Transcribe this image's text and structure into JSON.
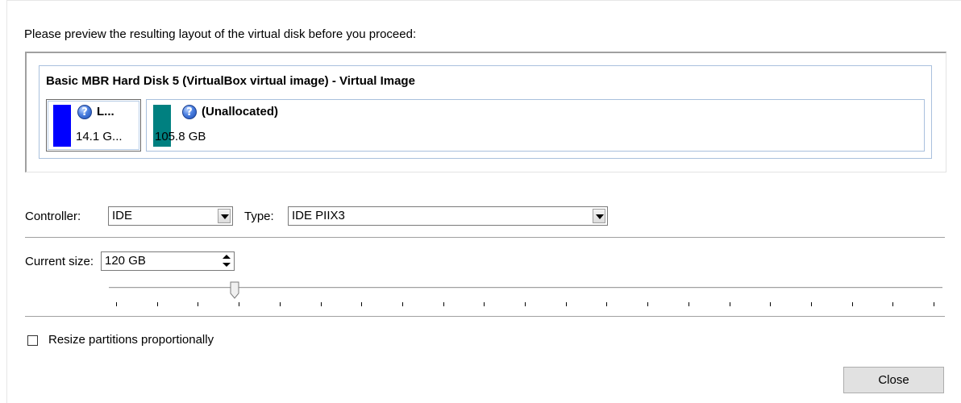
{
  "intro_text": "Please preview the resulting layout of the virtual disk before you proceed:",
  "disk": {
    "title": "Basic MBR Hard Disk 5 (VirtualBox virtual image) - Virtual Image",
    "partitions": [
      {
        "name": "L...",
        "size": "14.1 G...",
        "color": "#0000ff",
        "icon": "question-icon",
        "selected": true
      },
      {
        "name": "(Unallocated)",
        "size": "105.8 GB",
        "color": "#008080",
        "icon": "question-icon",
        "selected": false
      }
    ]
  },
  "controller": {
    "label": "Controller:",
    "value": "IDE"
  },
  "type": {
    "label": "Type:",
    "value": "IDE PIIX3"
  },
  "current_size": {
    "label": "Current size:",
    "value": "120 GB"
  },
  "slider": {
    "level": 0.15,
    "tick_count": 21
  },
  "resize_checkbox": {
    "label": "Resize partitions proportionally",
    "checked": false
  },
  "close_button": {
    "label": "Close"
  }
}
